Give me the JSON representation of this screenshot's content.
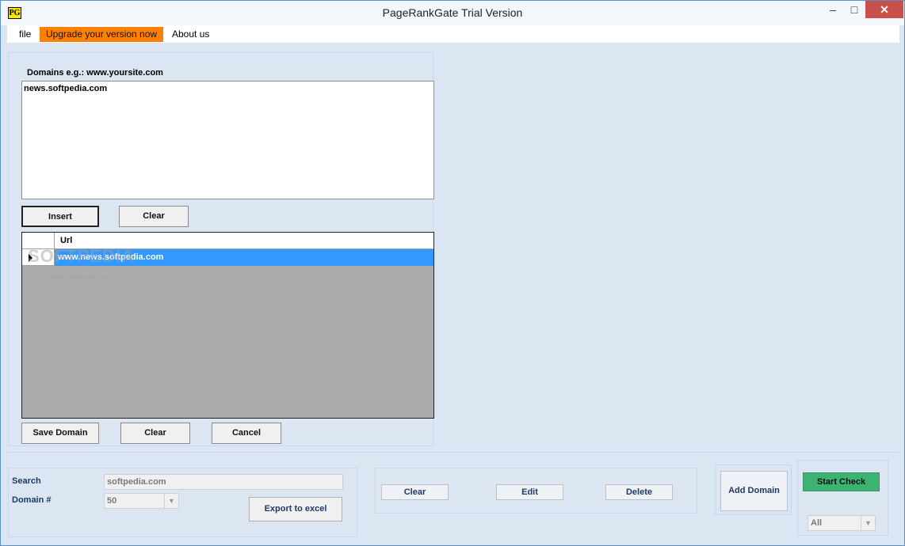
{
  "window": {
    "icon_text": "PG",
    "title": "PageRankGate Trial Version",
    "min_glyph": "–",
    "max_glyph": "□",
    "close_glyph": "✕"
  },
  "menu": {
    "file": "file",
    "upgrade": "Upgrade your version now",
    "about": "About us",
    "upgrade_color": "#ff8000"
  },
  "domains": {
    "label": "Domains  e.g.:  www.yoursite.com",
    "value": "news.softpedia.com",
    "insert_label": "Insert",
    "clear_label": "Clear"
  },
  "grid": {
    "column": "Url",
    "rows": [
      {
        "url": "www.news.softpedia.com",
        "selected": true
      }
    ],
    "selection_color": "#3399ff"
  },
  "domain_actions": {
    "save_label": "Save Domain",
    "clear_label": "Clear",
    "cancel_label": "Cancel"
  },
  "watermark": {
    "text": "SOFTPEDIA",
    "sub": "www.softpedia.com"
  },
  "search": {
    "label": "Search",
    "value": "softpedia.com",
    "domain_label": "Domain #",
    "domain_value": "50",
    "export_label": "Export to excel"
  },
  "actions": {
    "clear_label": "Clear",
    "edit_label": "Edit",
    "delete_label": "Delete",
    "add_domain_label": "Add Domain"
  },
  "check": {
    "start_label": "Start Check",
    "start_color": "#3cb371",
    "filter_value": "All"
  }
}
